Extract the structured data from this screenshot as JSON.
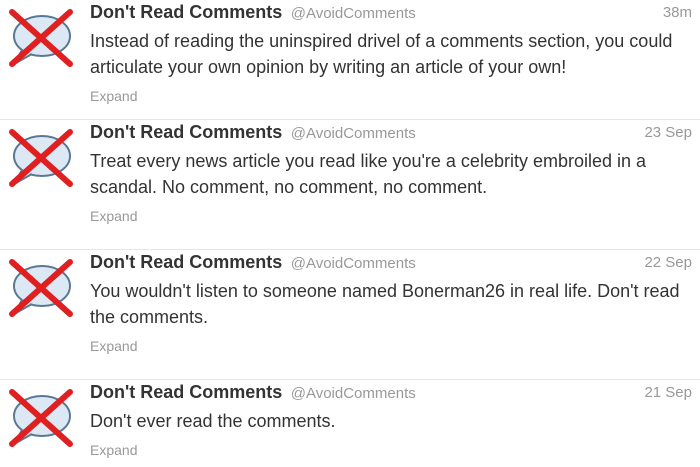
{
  "tweets": [
    {
      "name": "Don't Read Comments",
      "handle": "@AvoidComments",
      "time": "38m",
      "text": "Instead of reading the uninspired drivel of a comments section, you could articulate your own opinion by writing an article of your own!",
      "expand": "Expand",
      "avatar_icon": "crossed-out-speech-bubble-icon"
    },
    {
      "name": "Don't Read Comments",
      "handle": "@AvoidComments",
      "time": "23 Sep",
      "text": "Treat every news article you read like you're a celebrity embroiled in a scandal. No comment, no comment, no comment.",
      "expand": "Expand",
      "avatar_icon": "crossed-out-speech-bubble-icon"
    },
    {
      "name": "Don't Read Comments",
      "handle": "@AvoidComments",
      "time": "22 Sep",
      "text": "You wouldn't listen to someone named Bonerman26 in real life. Don't read the comments.",
      "expand": "Expand",
      "avatar_icon": "crossed-out-speech-bubble-icon"
    },
    {
      "name": "Don't Read Comments",
      "handle": "@AvoidComments",
      "time": "21 Sep",
      "text": "Don't ever read the comments.",
      "expand": "Expand",
      "avatar_icon": "crossed-out-speech-bubble-icon"
    }
  ],
  "colors": {
    "x_mark": "#e02020",
    "bubble_fill": "#dce9f5",
    "bubble_stroke": "#5a7894"
  }
}
